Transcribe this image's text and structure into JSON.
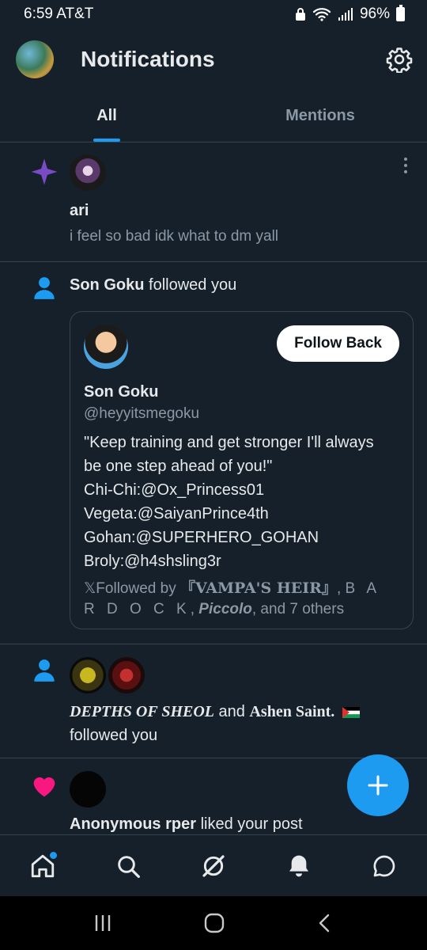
{
  "status_bar": {
    "time": "6:59 AT&T",
    "battery": "96%"
  },
  "header": {
    "title": "Notifications"
  },
  "tabs": [
    {
      "label": "All",
      "active": true
    },
    {
      "label": "Mentions",
      "active": false
    }
  ],
  "notifications": {
    "post": {
      "icon": "sparkle-icon",
      "name": "ari",
      "text": "i feel so bad idk what to dm yall"
    },
    "follow": {
      "icon": "person-icon",
      "follower": "Son Goku",
      "action": "followed you",
      "card": {
        "button": "Follow Back",
        "name": "Son Goku",
        "handle": "@heyyitsmegoku",
        "bio_lines": [
          "\"Keep training and get stronger I'll always",
          "be one step ahead of you!\"",
          "Chi-Chi:@Ox_Princess01",
          "Vegeta:@SaiyanPrince4th",
          "Gohan:@SUPERHERO_GOHAN",
          "Broly:@h4shsling3r"
        ],
        "followed_by_prefix": "𝕏Followed by ",
        "followed_by_1": "『VAMPA'S HEIR』",
        "comma": ", ",
        "followed_by_2": "B A R D O C K",
        "followed_by_3": "Piccolo",
        "followed_by_suffix": ", and 7 others"
      }
    },
    "multi_follow": {
      "name1": "DEPTHS OF SHEOL",
      "and": " and ",
      "name2": "Ashen Saint.",
      "action": "followed you"
    },
    "like": {
      "icon": "heart-icon",
      "name": "Anonymous rper",
      "action": " liked your post"
    }
  },
  "colors": {
    "accent": "#1d9bf0",
    "background": "#15202b",
    "heart": "#f91880",
    "sparkle": "#794bc4"
  }
}
